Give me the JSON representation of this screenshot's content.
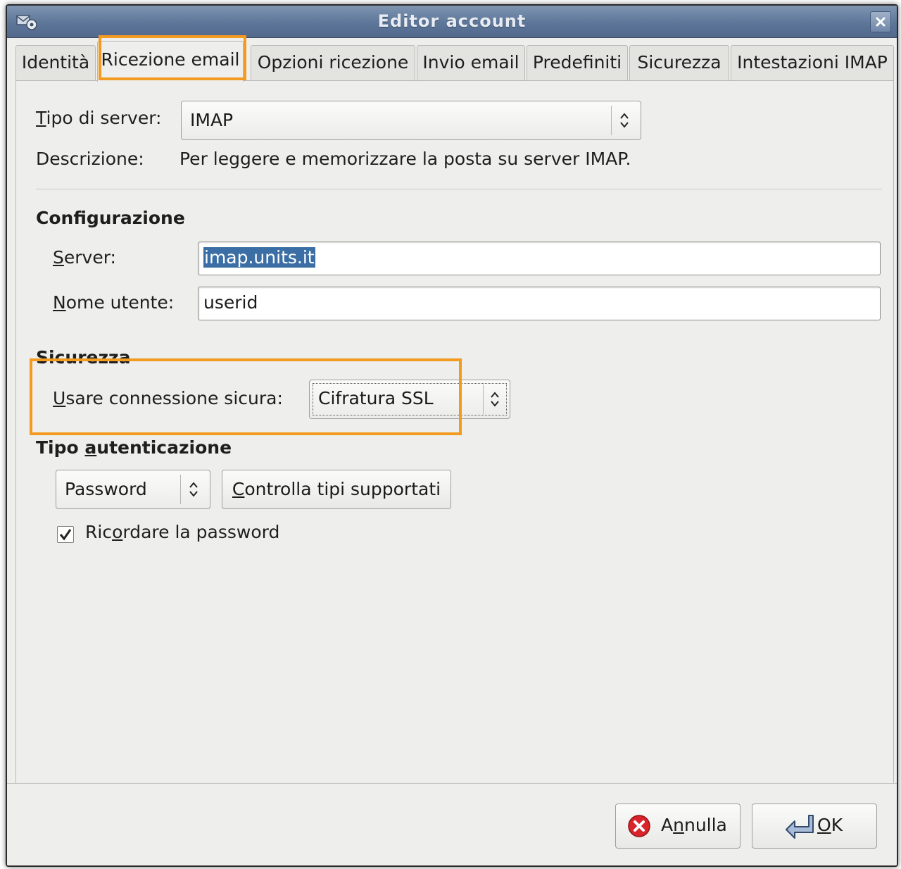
{
  "window": {
    "title": "Editor account",
    "close_label": "×"
  },
  "icons": {
    "app": "mail-settings-icon",
    "close": "close-icon",
    "cancel": "cancel-icon",
    "ok": "ok-return-icon",
    "spin": "up-down-arrows-icon"
  },
  "tabs": [
    {
      "label": "Identità"
    },
    {
      "label": "Ricezione email",
      "active": true
    },
    {
      "label": "Opzioni ricezione"
    },
    {
      "label": "Invio email"
    },
    {
      "label": "Predefiniti"
    },
    {
      "label": "Sicurezza"
    },
    {
      "label": "Intestazioni IMAP"
    }
  ],
  "server_type": {
    "label_pre": "",
    "label_mnemonic": "T",
    "label_post": "ipo di server:",
    "value": "IMAP"
  },
  "description": {
    "label": "Descrizione:",
    "value": "Per leggere e memorizzare la posta su server IMAP."
  },
  "config": {
    "heading": "Configurazione",
    "server": {
      "label_mnemonic": "S",
      "label_post": "erver:",
      "value": "imap.units.it"
    },
    "username": {
      "label_mnemonic": "N",
      "label_post": "ome utente:",
      "value": "userid"
    }
  },
  "security": {
    "heading": "Sicurezza",
    "label_mnemonic": "U",
    "label_post": "sare connessione sicura:",
    "value": "Cifratura SSL"
  },
  "auth": {
    "heading_pre": "Tipo ",
    "heading_mnemonic": "a",
    "heading_post": "utenticazione",
    "value": "Password",
    "check_btn_mnemonic": "C",
    "check_btn_post": "ontrolla tipi supportati",
    "remember_pre": "Ric",
    "remember_mnemonic": "o",
    "remember_post": "rdare la password",
    "remember_checked": true
  },
  "buttons": {
    "cancel_pre": "A",
    "cancel_mnemonic": "n",
    "cancel_post": "nulla",
    "ok_mnemonic": "O",
    "ok_post": "K"
  },
  "colors": {
    "highlight": "#f39a20",
    "selection": "#3a6ea5",
    "titlebar": "#5d7699"
  }
}
